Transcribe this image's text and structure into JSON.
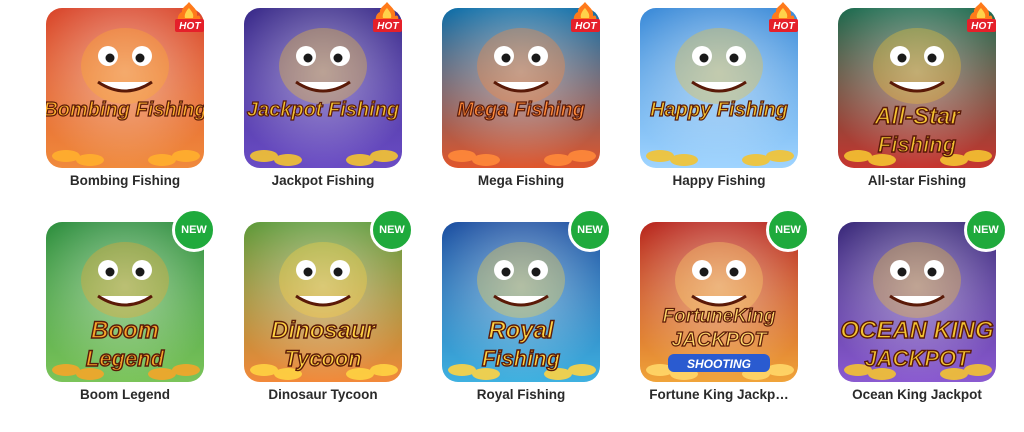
{
  "games": [
    {
      "title": "Bombing Fishing",
      "logo": "Bombing Fishing",
      "badge": "HOT",
      "colors": [
        "#d9462b",
        "#f08a3c",
        "#ffb02e"
      ]
    },
    {
      "title": "Jackpot Fishing",
      "logo": "Jackpot Fishing",
      "badge": "HOT",
      "colors": [
        "#3a2b8a",
        "#6a4cc4",
        "#f4c431"
      ]
    },
    {
      "title": "Mega Fishing",
      "logo": "Mega Fishing",
      "badge": "HOT",
      "colors": [
        "#0e6ea8",
        "#e0562c",
        "#ff8a3a"
      ]
    },
    {
      "title": "Happy Fishing",
      "logo": "Happy Fishing",
      "badge": "HOT",
      "colors": [
        "#3a8ad8",
        "#9fd4ff",
        "#f4c431"
      ]
    },
    {
      "title": "All-star Fishing",
      "logo": "All-Star",
      "logo2": "Fishing",
      "badge": "HOT",
      "colors": [
        "#1d6b4f",
        "#c7352f",
        "#f4c431"
      ]
    },
    {
      "title": "Boom Legend",
      "logo": "Boom",
      "logo2": "Legend",
      "badge": "NEW",
      "colors": [
        "#2e8f3f",
        "#7bc45a",
        "#f4a62a"
      ]
    },
    {
      "title": "Dinosaur Tycoon",
      "logo": "Dinosaur",
      "logo2": "Tycoon",
      "badge": "NEW",
      "colors": [
        "#5e9a3a",
        "#f2893a",
        "#ffd342"
      ]
    },
    {
      "title": "Royal Fishing",
      "logo": "Royal",
      "logo2": "Fishing",
      "badge": "NEW",
      "colors": [
        "#1c4fa1",
        "#3fb1e0",
        "#ffd342"
      ]
    },
    {
      "title": "Fortune King Jackp…",
      "logo": "FortuneKing",
      "logo2": "JACKPOT",
      "logo3": "SHOOTING",
      "badge": "NEW",
      "colors": [
        "#b8261e",
        "#f0a43a",
        "#ffd86a"
      ]
    },
    {
      "title": "Ocean King Jackpot",
      "logo": "OCEAN KING",
      "logo2": "JACKPOT",
      "badge": "NEW",
      "colors": [
        "#3a2a7a",
        "#8a5ad0",
        "#f4c431"
      ]
    }
  ]
}
